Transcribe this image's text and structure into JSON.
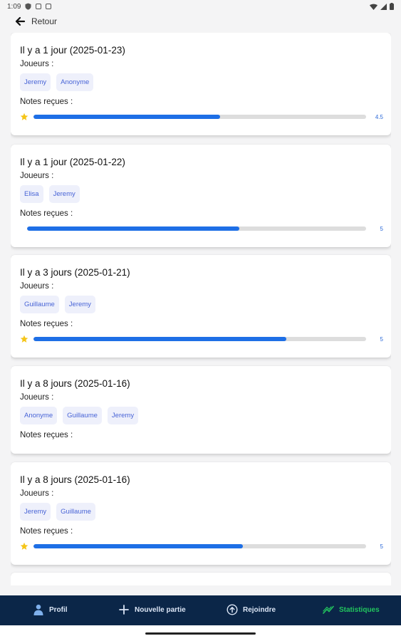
{
  "status_bar": {
    "time": "1:09"
  },
  "header": {
    "back_label": "Retour"
  },
  "games": [
    {
      "title": "Il y a 1 jour (2025-01-23)",
      "players_label": "Joueurs :",
      "players": [
        "Jeremy",
        "Anonyme"
      ],
      "notes_label": "Notes reçues :",
      "rating": {
        "show_star": true,
        "value_label": "4.5",
        "fill_fraction": 0.56
      }
    },
    {
      "title": "Il y a 1 jour (2025-01-22)",
      "players_label": "Joueurs :",
      "players": [
        "Elisa",
        "Jeremy"
      ],
      "notes_label": "Notes reçues :",
      "rating": {
        "show_star": false,
        "value_label": "5",
        "fill_fraction": 0.626
      }
    },
    {
      "title": "Il y a 3 jours (2025-01-21)",
      "players_label": "Joueurs :",
      "players": [
        "Guillaume",
        "Jeremy"
      ],
      "notes_label": "Notes reçues :",
      "rating": {
        "show_star": true,
        "value_label": "5",
        "fill_fraction": 0.76
      }
    },
    {
      "title": "Il y a 8 jours (2025-01-16)",
      "players_label": "Joueurs :",
      "players": [
        "Anonyme",
        "Guillaume",
        "Jeremy"
      ],
      "notes_label": "Notes reçues :",
      "rating": null
    },
    {
      "title": "Il y a 8 jours (2025-01-16)",
      "players_label": "Joueurs :",
      "players": [
        "Jeremy",
        "Guillaume"
      ],
      "notes_label": "Notes reçues :",
      "rating": {
        "show_star": true,
        "value_label": "5",
        "fill_fraction": 0.63
      }
    }
  ],
  "bottom_nav": {
    "items": [
      {
        "label": "Profil",
        "icon": "person-icon",
        "active": false
      },
      {
        "label": "Nouvelle partie",
        "icon": "plus-icon",
        "active": false
      },
      {
        "label": "Rejoindre",
        "icon": "circle-arrow-up-icon",
        "active": false
      },
      {
        "label": "Statistiques",
        "icon": "trending-up-icon",
        "active": true
      }
    ]
  },
  "colors": {
    "accent": "#1e6fe6",
    "chip_bg": "#eef0fb",
    "chip_text": "#4763d6",
    "nav_bg": "#0b2648",
    "nav_active": "#22c55e",
    "star": "#f5c518"
  }
}
